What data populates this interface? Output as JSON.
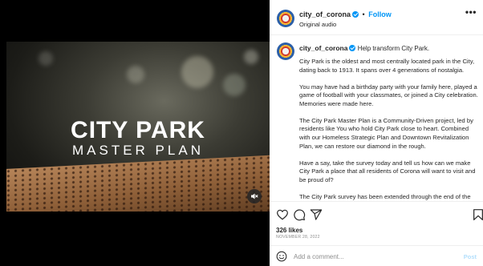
{
  "header": {
    "username": "city_of_corona",
    "separator": "•",
    "follow_label": "Follow",
    "subtitle": "Original audio",
    "more_icon": "more-horizontal-icon"
  },
  "video": {
    "title_line1": "CITY PARK",
    "title_line2": "MASTER PLAN",
    "mute_icon": "speaker-muted-icon"
  },
  "caption": {
    "username": "city_of_corona",
    "headline": "Help transform City Park.",
    "paragraphs": [
      "City Park is the oldest and most centrally located park in the City, dating back to 1913. It spans over 4 generations of nostalgia.",
      "You may have had a birthday party with your family here, played a game of football with your classmates, or joined a City celebration. Memories were made here.",
      "The City Park Master Plan is a Community-Driven project, led by residents like You who hold City Park close to heart. Combined with our Homeless Strategic Plan and Downtown Revitalization Plan, we can restore our diamond in the rough.",
      "Have a say, take the survey today and tell us how can we make City Park a place that all residents of Corona will want to visit and be proud of?",
      "The City Park survey has been extended through the end of the year."
    ]
  },
  "actions": {
    "icons": [
      "heart-icon",
      "comment-icon",
      "share-icon",
      "bookmark-icon"
    ]
  },
  "stats": {
    "likes": "326 likes",
    "date": "NOVEMBER 28, 2022"
  },
  "comment": {
    "placeholder": "Add a comment...",
    "post_label": "Post"
  },
  "colors": {
    "accent": "#0095f6",
    "post_disabled": "#b2dffc",
    "muted_text": "#8e8e8e"
  }
}
